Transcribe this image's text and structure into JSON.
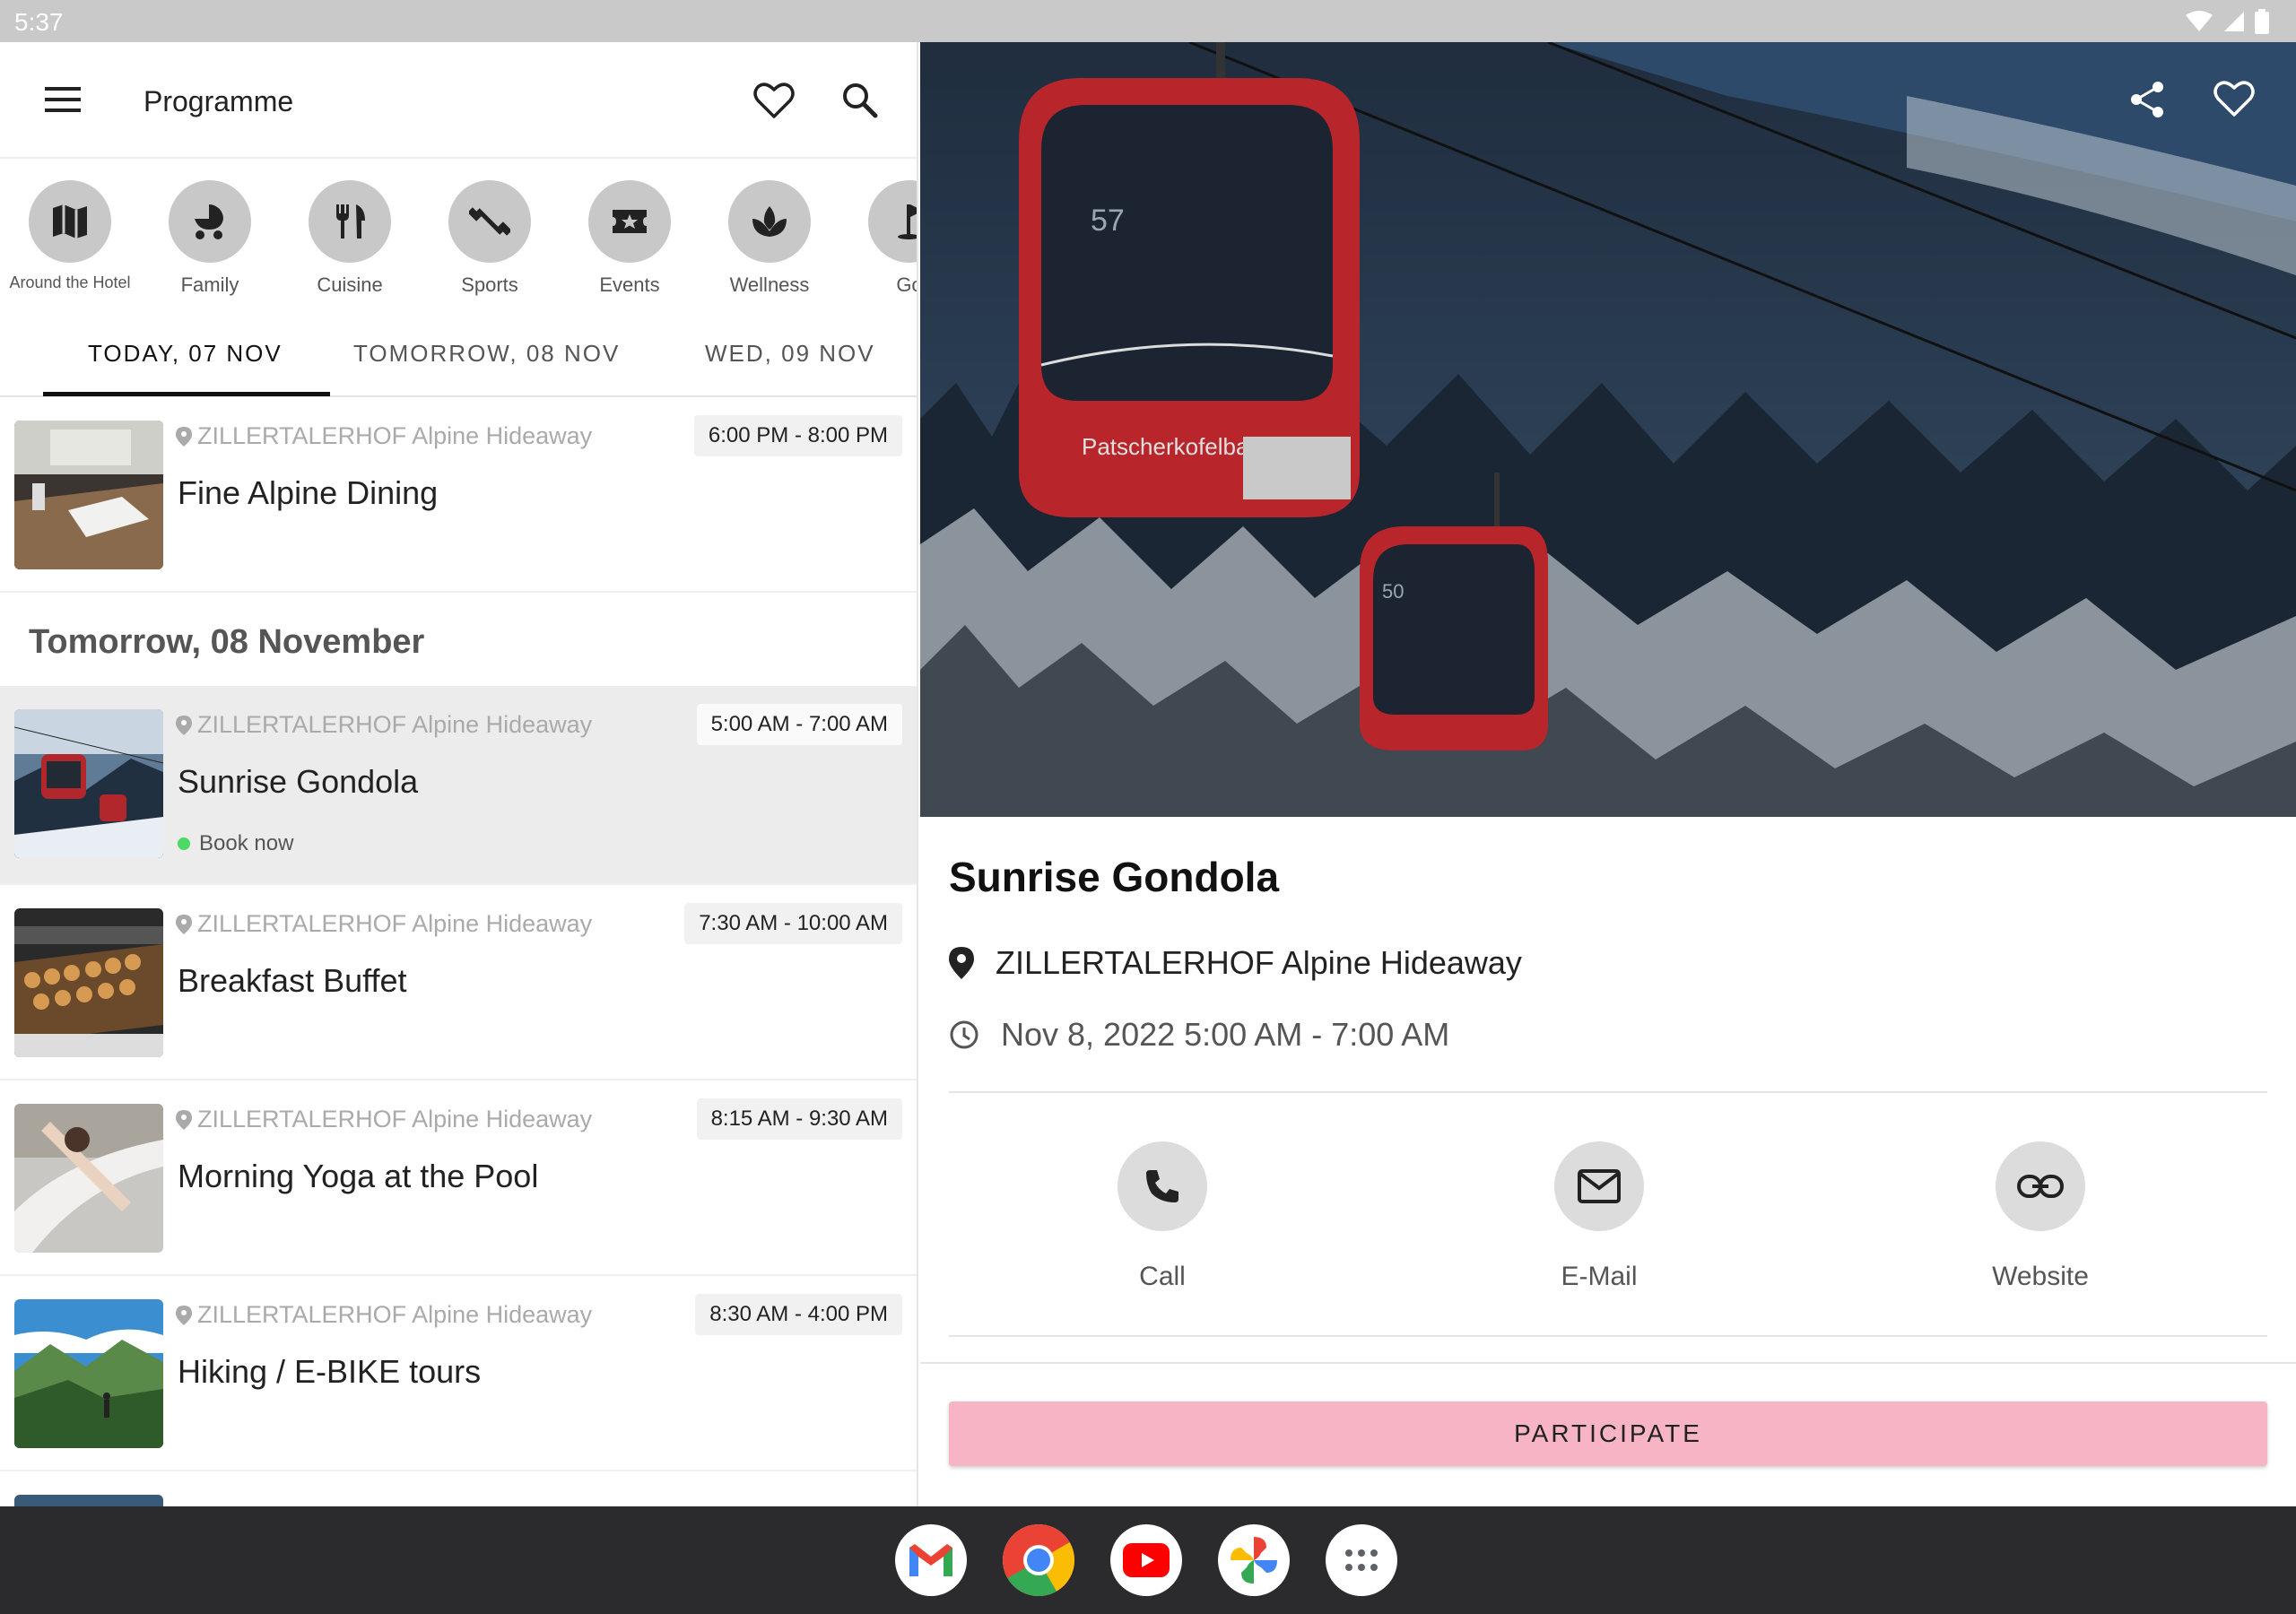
{
  "status": {
    "time": "5:37"
  },
  "appbar": {
    "title": "Programme"
  },
  "categories": [
    {
      "label": "Around the Hotel",
      "icon": "map-icon"
    },
    {
      "label": "Family",
      "icon": "stroller-icon"
    },
    {
      "label": "Cuisine",
      "icon": "cutlery-icon"
    },
    {
      "label": "Sports",
      "icon": "dumbbell-icon"
    },
    {
      "label": "Events",
      "icon": "ticket-icon"
    },
    {
      "label": "Wellness",
      "icon": "lotus-icon"
    },
    {
      "label": "Go",
      "icon": "golf-flag-icon"
    }
  ],
  "tabs": [
    {
      "label": "TODAY, 07 NOV"
    },
    {
      "label": "TOMORROW, 08 NOV"
    },
    {
      "label": "WED, 09 NOV"
    }
  ],
  "sections": {
    "tomorrow": "Tomorrow, 08 November"
  },
  "events": [
    {
      "location": "ZILLERTALERHOF Alpine Hideaway",
      "time": "6:00 PM - 8:00 PM",
      "title": "Fine Alpine Dining"
    },
    {
      "location": "ZILLERTALERHOF Alpine Hideaway",
      "time": "5:00 AM - 7:00 AM",
      "title": "Sunrise Gondola",
      "badge": "Book now"
    },
    {
      "location": "ZILLERTALERHOF Alpine Hideaway",
      "time": "7:30 AM - 10:00 AM",
      "title": "Breakfast Buffet"
    },
    {
      "location": "ZILLERTALERHOF Alpine Hideaway",
      "time": "8:15 AM - 9:30 AM",
      "title": "Morning Yoga at the Pool"
    },
    {
      "location": "ZILLERTALERHOF Alpine Hideaway",
      "time": "8:30 AM - 4:00 PM",
      "title": "Hiking / E-BIKE tours"
    }
  ],
  "detail": {
    "title": "Sunrise Gondola",
    "location": "ZILLERTALERHOF Alpine Hideaway",
    "datetime": "Nov 8, 2022 5:00 AM - 7:00 AM",
    "actions": {
      "call": "Call",
      "email": "E-Mail",
      "website": "Website"
    },
    "participate": "PARTICIPATE"
  },
  "hero_text": {
    "gondola_sign": "Patscherkofelbahn",
    "gondola_number": "57",
    "gondola_number_2": "50"
  },
  "colors": {
    "accent": "#f6b4c4",
    "status_dot": "#4cd964"
  }
}
